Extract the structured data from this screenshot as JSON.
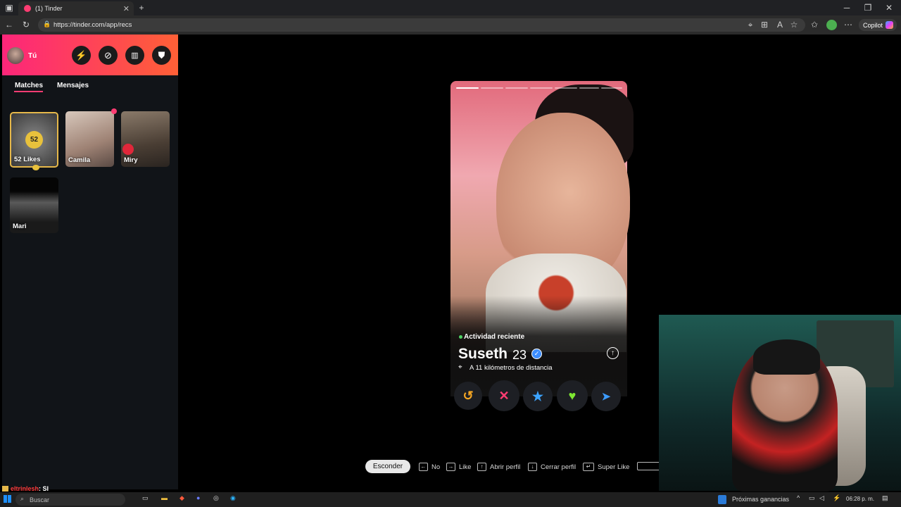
{
  "browser": {
    "tab_title": "(1) Tinder",
    "url": "https://tinder.com/app/recs",
    "copilot_label": "Copilot"
  },
  "sidebar": {
    "user_label": "Tú",
    "tabs": [
      {
        "label": "Matches"
      },
      {
        "label": "Mensajes"
      }
    ],
    "likes": {
      "count": "52",
      "label": "52 Likes"
    },
    "matches": [
      {
        "name": "Camila"
      },
      {
        "name": "Miry"
      },
      {
        "name": "Mari"
      }
    ]
  },
  "card": {
    "activity": "Actividad reciente",
    "name": "Suseth",
    "age": "23",
    "distance": "A 11 kilómetros de distancia"
  },
  "shortcuts": {
    "hide_label": "Esconder",
    "items": [
      {
        "label": "No"
      },
      {
        "label": "Like"
      },
      {
        "label": "Abrir perfil"
      },
      {
        "label": "Cerrar perfil"
      },
      {
        "label": "Super Like"
      }
    ]
  },
  "chat": {
    "user": "eltrinlesh",
    "message": ": SI"
  },
  "taskbar": {
    "search_placeholder": "Buscar",
    "widget": "Próximas ganancias",
    "time": "06:28 p. m."
  },
  "colors": {
    "brand_start": "#fd267a",
    "brand_end": "#ff6036",
    "like": "#7ee832",
    "nope": "#fe3c72",
    "superlike": "#3ca4ff",
    "rewind": "#f5a623",
    "boost": "#3c9bff"
  }
}
